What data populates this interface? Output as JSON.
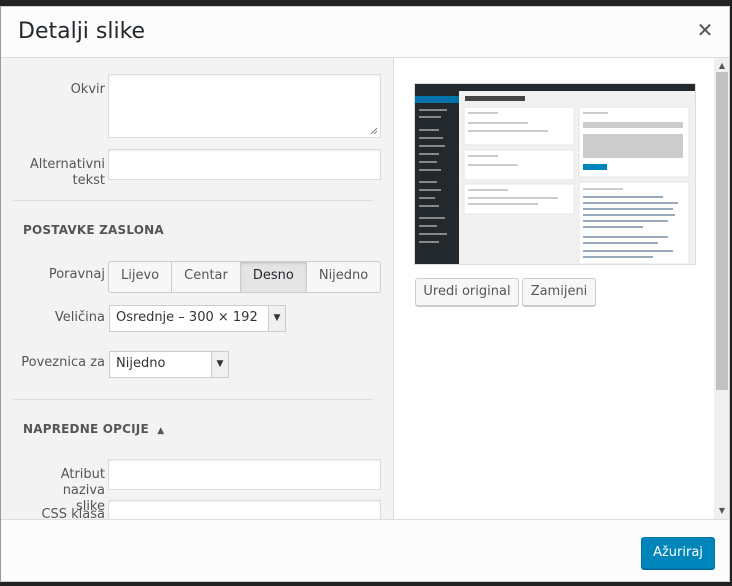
{
  "dialog": {
    "title": "Detalji slike"
  },
  "fields": {
    "caption_label": "Okvir",
    "alt_label": "Alternativni tekst",
    "alt_label_1": "Alternativni",
    "alt_label_2": "tekst"
  },
  "display": {
    "section": "POSTAVKE ZASLONA",
    "align_label": "Poravnaj",
    "align_options": [
      "Lijevo",
      "Centar",
      "Desno",
      "Nijedno"
    ],
    "align_selected": "Desno",
    "size_label": "Veličina",
    "size_value": "Osrednje – 300 × 192",
    "link_label": "Poveznica za",
    "link_value": "Nijedno"
  },
  "advanced": {
    "section": "NAPREDNE OPCIJE",
    "title_attr_label_1": "Atribut naziva",
    "title_attr_label_2": "slike",
    "css_label": "CSS klasa slike"
  },
  "image_actions": {
    "edit_original": "Uredi original",
    "replace": "Zamijeni"
  },
  "footer": {
    "update": "Ažuriraj"
  },
  "colors": {
    "primary": "#0085ba",
    "admin_bar": "#23282d"
  }
}
